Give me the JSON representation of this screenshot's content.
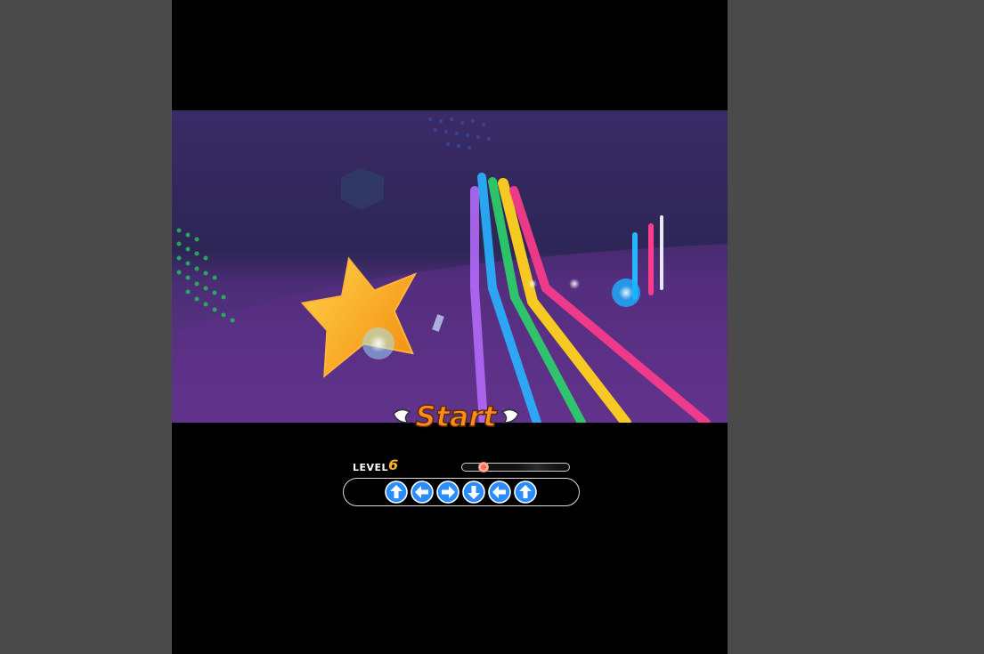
{
  "game": {
    "banner_text": "Start",
    "level_label": "LEVEL",
    "level_value": "6",
    "progress": 0.15,
    "arrows": [
      "up-arrow-icon",
      "left-arrow-icon",
      "right-arrow-icon",
      "down-arrow-icon",
      "left-arrow-icon",
      "up-arrow-icon"
    ],
    "colors": {
      "arrow_fill": "#2a8cff",
      "level_value": "#ffb428",
      "banner_fill": "#ff8a1e",
      "lane_colors": [
        "#b86cff",
        "#28b4ff",
        "#2bd46a",
        "#ffd21e",
        "#ff3c8c"
      ]
    }
  }
}
